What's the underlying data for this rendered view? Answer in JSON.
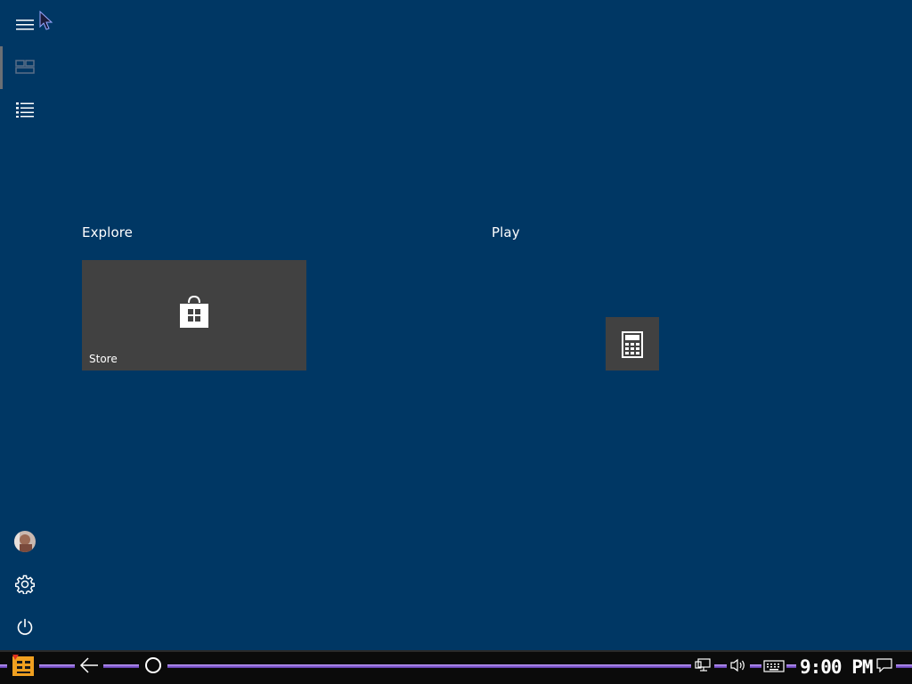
{
  "start_menu": {
    "groups": [
      {
        "title": "Explore"
      },
      {
        "title": "Play"
      }
    ],
    "tiles": {
      "store": {
        "label": "Store",
        "icon": "store-bag-icon"
      },
      "calculator": {
        "label": "",
        "icon": "calculator-icon"
      }
    },
    "rail": {
      "items": [
        "hamburger-menu-icon",
        "tiles-view-icon",
        "all-apps-list-icon"
      ],
      "bottom_items": [
        "user-avatar",
        "settings-gear-icon",
        "power-icon"
      ]
    }
  },
  "taskbar": {
    "clock": "9:00 PM",
    "items": [
      "start-logo-icon",
      "back-arrow-icon",
      "search-circle-icon"
    ],
    "tray": [
      "network-icon",
      "volume-icon",
      "keyboard-icon",
      "action-center-icon"
    ],
    "accent_line_color": "#8a62d6"
  },
  "colors": {
    "background": "#003764",
    "tile": "#414141",
    "taskbar": "#0b0b0b"
  }
}
